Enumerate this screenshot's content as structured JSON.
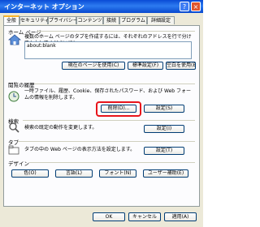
{
  "window": {
    "title": "インターネット オプション",
    "help": "?",
    "close": "×"
  },
  "tabs": [
    "全般",
    "セキュリティ",
    "プライバシー",
    "コンテンツ",
    "接続",
    "プログラム",
    "詳細設定"
  ],
  "home": {
    "group": "ホーム ページ",
    "desc": "複数のホーム ページのタブを作成するには、それぞれのアドレスを行で分けて入力してください(R)。",
    "value": "about:blank",
    "buttons": [
      "現在のページを使用(C)",
      "標準設定(F)",
      "空白を使用(B)"
    ]
  },
  "history": {
    "group": "閲覧の履歴",
    "desc": "一時ファイル、履歴、Cookie、保存されたパスワード、および Web フォームの情報を削除します。",
    "delete": "削除(D)...",
    "settings": "設定(S)"
  },
  "search": {
    "group": "検索",
    "desc": "検索の既定の動作を変更します。",
    "settings": "設定(I)"
  },
  "tabsec": {
    "group": "タブ",
    "desc": "タブの中の Web ページの表示方法を設定します。",
    "settings": "設定(T)"
  },
  "design": {
    "group": "デザイン",
    "buttons": [
      "色(O)",
      "言語(L)",
      "フォント(N)",
      "ユーザー補助(E)"
    ]
  },
  "footer": {
    "ok": "OK",
    "cancel": "キャンセル",
    "apply": "適用(A)"
  }
}
